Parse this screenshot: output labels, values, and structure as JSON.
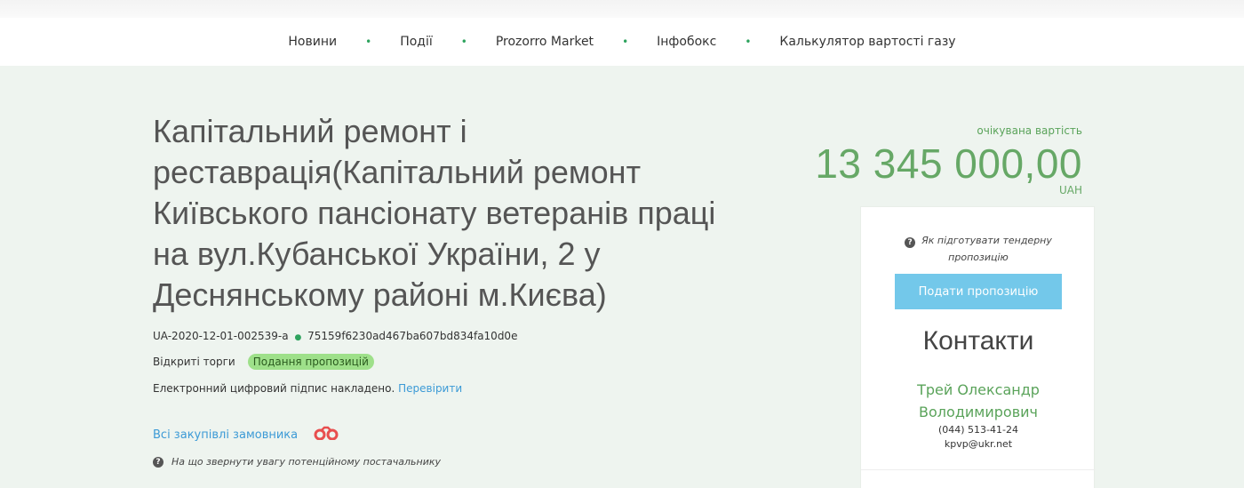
{
  "nav": {
    "items": [
      "Новини",
      "Події",
      "Prozorro Market",
      "Інфобокс",
      "Калькулятор вартості газу"
    ],
    "separator": "•"
  },
  "tender": {
    "title": "Капітальний ремонт і реставрація(Капітальний ремонт Київського пансіонату ветеранів праці на вул.Кубанської України, 2 у Деснянському районі м.Києва)",
    "id": "UA-2020-12-01-002539-a",
    "hash": "75159f6230ad467ba607bd834fa10d0e",
    "procedure": "Відкриті торги",
    "status": "Подання пропозицій",
    "signature_text": "Електронний цифровий підпис накладено.",
    "verify_link": "Перевірити",
    "customer_link": "Всі закупівлі замовника",
    "supplier_hint": "На що звернути увагу потенційному постачальнику"
  },
  "price": {
    "label": "очікувана вартість",
    "amount": "13 345 000,00",
    "currency": "UAH"
  },
  "panel": {
    "hint": "Як підготувати тендерну пропозицію",
    "submit_label": "Подати пропозицію",
    "contacts_title": "Контакти",
    "contact_name": "Трей Олександр Володимирович",
    "phone": "(044) 513-41-24",
    "email": "kpvp@ukr.net"
  },
  "colors": {
    "accent_green": "#66a866",
    "link_blue": "#3c9ad6",
    "button_blue": "#73c8ea",
    "badge_green": "#9ee08a"
  }
}
